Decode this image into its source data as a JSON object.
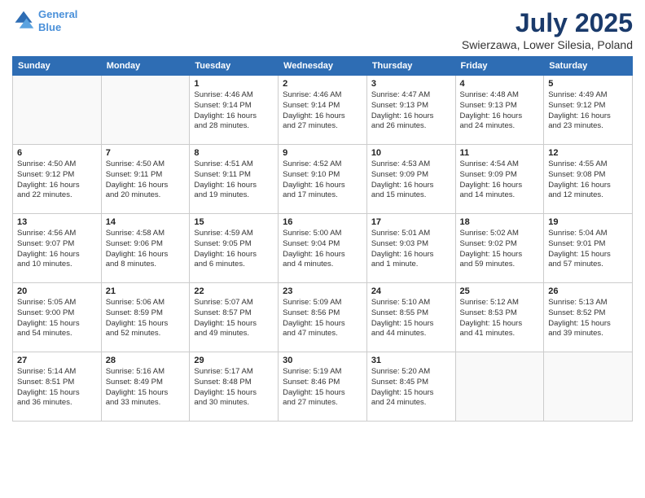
{
  "header": {
    "logo_line1": "General",
    "logo_line2": "Blue",
    "title": "July 2025",
    "subtitle": "Swierzawa, Lower Silesia, Poland"
  },
  "days_of_week": [
    "Sunday",
    "Monday",
    "Tuesday",
    "Wednesday",
    "Thursday",
    "Friday",
    "Saturday"
  ],
  "weeks": [
    [
      {
        "day": "",
        "info": ""
      },
      {
        "day": "",
        "info": ""
      },
      {
        "day": "1",
        "info": "Sunrise: 4:46 AM\nSunset: 9:14 PM\nDaylight: 16 hours\nand 28 minutes."
      },
      {
        "day": "2",
        "info": "Sunrise: 4:46 AM\nSunset: 9:14 PM\nDaylight: 16 hours\nand 27 minutes."
      },
      {
        "day": "3",
        "info": "Sunrise: 4:47 AM\nSunset: 9:13 PM\nDaylight: 16 hours\nand 26 minutes."
      },
      {
        "day": "4",
        "info": "Sunrise: 4:48 AM\nSunset: 9:13 PM\nDaylight: 16 hours\nand 24 minutes."
      },
      {
        "day": "5",
        "info": "Sunrise: 4:49 AM\nSunset: 9:12 PM\nDaylight: 16 hours\nand 23 minutes."
      }
    ],
    [
      {
        "day": "6",
        "info": "Sunrise: 4:50 AM\nSunset: 9:12 PM\nDaylight: 16 hours\nand 22 minutes."
      },
      {
        "day": "7",
        "info": "Sunrise: 4:50 AM\nSunset: 9:11 PM\nDaylight: 16 hours\nand 20 minutes."
      },
      {
        "day": "8",
        "info": "Sunrise: 4:51 AM\nSunset: 9:11 PM\nDaylight: 16 hours\nand 19 minutes."
      },
      {
        "day": "9",
        "info": "Sunrise: 4:52 AM\nSunset: 9:10 PM\nDaylight: 16 hours\nand 17 minutes."
      },
      {
        "day": "10",
        "info": "Sunrise: 4:53 AM\nSunset: 9:09 PM\nDaylight: 16 hours\nand 15 minutes."
      },
      {
        "day": "11",
        "info": "Sunrise: 4:54 AM\nSunset: 9:09 PM\nDaylight: 16 hours\nand 14 minutes."
      },
      {
        "day": "12",
        "info": "Sunrise: 4:55 AM\nSunset: 9:08 PM\nDaylight: 16 hours\nand 12 minutes."
      }
    ],
    [
      {
        "day": "13",
        "info": "Sunrise: 4:56 AM\nSunset: 9:07 PM\nDaylight: 16 hours\nand 10 minutes."
      },
      {
        "day": "14",
        "info": "Sunrise: 4:58 AM\nSunset: 9:06 PM\nDaylight: 16 hours\nand 8 minutes."
      },
      {
        "day": "15",
        "info": "Sunrise: 4:59 AM\nSunset: 9:05 PM\nDaylight: 16 hours\nand 6 minutes."
      },
      {
        "day": "16",
        "info": "Sunrise: 5:00 AM\nSunset: 9:04 PM\nDaylight: 16 hours\nand 4 minutes."
      },
      {
        "day": "17",
        "info": "Sunrise: 5:01 AM\nSunset: 9:03 PM\nDaylight: 16 hours\nand 1 minute."
      },
      {
        "day": "18",
        "info": "Sunrise: 5:02 AM\nSunset: 9:02 PM\nDaylight: 15 hours\nand 59 minutes."
      },
      {
        "day": "19",
        "info": "Sunrise: 5:04 AM\nSunset: 9:01 PM\nDaylight: 15 hours\nand 57 minutes."
      }
    ],
    [
      {
        "day": "20",
        "info": "Sunrise: 5:05 AM\nSunset: 9:00 PM\nDaylight: 15 hours\nand 54 minutes."
      },
      {
        "day": "21",
        "info": "Sunrise: 5:06 AM\nSunset: 8:59 PM\nDaylight: 15 hours\nand 52 minutes."
      },
      {
        "day": "22",
        "info": "Sunrise: 5:07 AM\nSunset: 8:57 PM\nDaylight: 15 hours\nand 49 minutes."
      },
      {
        "day": "23",
        "info": "Sunrise: 5:09 AM\nSunset: 8:56 PM\nDaylight: 15 hours\nand 47 minutes."
      },
      {
        "day": "24",
        "info": "Sunrise: 5:10 AM\nSunset: 8:55 PM\nDaylight: 15 hours\nand 44 minutes."
      },
      {
        "day": "25",
        "info": "Sunrise: 5:12 AM\nSunset: 8:53 PM\nDaylight: 15 hours\nand 41 minutes."
      },
      {
        "day": "26",
        "info": "Sunrise: 5:13 AM\nSunset: 8:52 PM\nDaylight: 15 hours\nand 39 minutes."
      }
    ],
    [
      {
        "day": "27",
        "info": "Sunrise: 5:14 AM\nSunset: 8:51 PM\nDaylight: 15 hours\nand 36 minutes."
      },
      {
        "day": "28",
        "info": "Sunrise: 5:16 AM\nSunset: 8:49 PM\nDaylight: 15 hours\nand 33 minutes."
      },
      {
        "day": "29",
        "info": "Sunrise: 5:17 AM\nSunset: 8:48 PM\nDaylight: 15 hours\nand 30 minutes."
      },
      {
        "day": "30",
        "info": "Sunrise: 5:19 AM\nSunset: 8:46 PM\nDaylight: 15 hours\nand 27 minutes."
      },
      {
        "day": "31",
        "info": "Sunrise: 5:20 AM\nSunset: 8:45 PM\nDaylight: 15 hours\nand 24 minutes."
      },
      {
        "day": "",
        "info": ""
      },
      {
        "day": "",
        "info": ""
      }
    ]
  ]
}
